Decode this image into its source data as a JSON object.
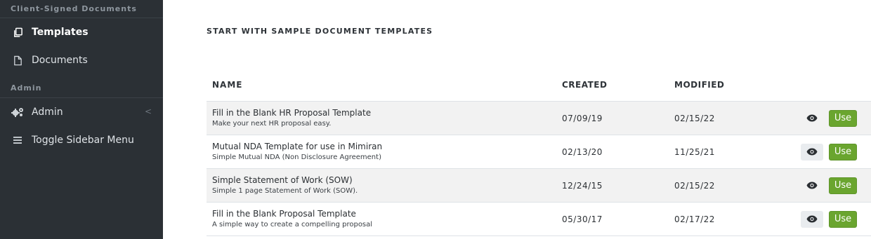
{
  "sidebar": {
    "client_section_label": "Client-Signed Documents",
    "items_top": [
      {
        "label": "Templates",
        "icon": "copy-icon"
      },
      {
        "label": "Documents",
        "icon": "file-icon"
      }
    ],
    "admin_section_label": "Admin",
    "items_admin": [
      {
        "label": "Admin",
        "icon": "cogs-icon",
        "chevron": "<"
      },
      {
        "label": "Toggle Sidebar Menu",
        "icon": "menu-icon"
      }
    ]
  },
  "main": {
    "heading": "START WITH SAMPLE DOCUMENT TEMPLATES",
    "table": {
      "headers": {
        "name": "NAME",
        "created": "CREATED",
        "modified": "MODIFIED"
      },
      "rows": [
        {
          "title": "Fill in the Blank HR Proposal Template",
          "description": "Make your next HR proposal easy.",
          "created": "07/09/19",
          "modified": "02/15/22",
          "use_label": "Use"
        },
        {
          "title": "Mutual NDA Template for use in Mimiran",
          "description": "Simple Mutual NDA (Non Disclosure Agreement)",
          "created": "02/13/20",
          "modified": "11/25/21",
          "use_label": "Use"
        },
        {
          "title": "Simple Statement of Work (SOW)",
          "description": "Simple 1 page Statement of Work (SOW).",
          "created": "12/24/15",
          "modified": "02/15/22",
          "use_label": "Use"
        },
        {
          "title": "Fill in the Blank Proposal Template",
          "description": "A simple way to create a compelling proposal",
          "created": "05/30/17",
          "modified": "02/17/22",
          "use_label": "Use"
        }
      ]
    }
  },
  "colors": {
    "sidebar_bg": "#2b3035",
    "use_button": "#6aa52f",
    "stripe": "#f2f2f2"
  }
}
